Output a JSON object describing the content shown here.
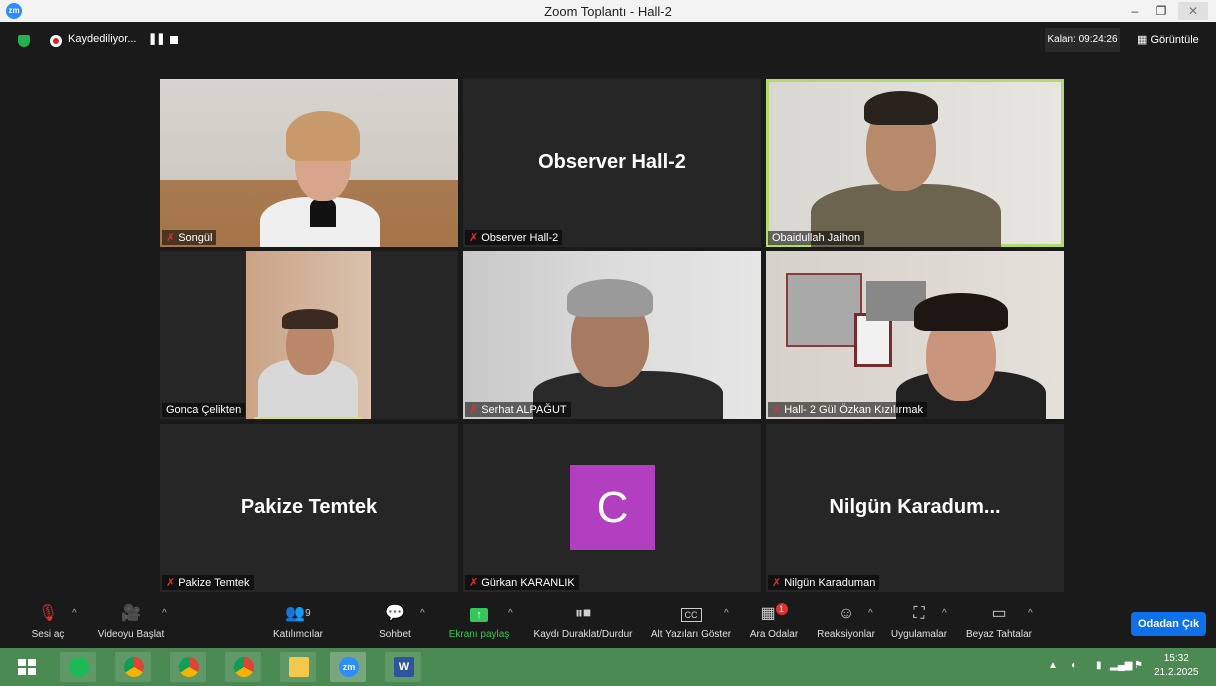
{
  "window": {
    "title": "Zoom Toplantı - Hall-2",
    "logo": "zm",
    "minimize": "–",
    "maximize": "❐",
    "close": "✕"
  },
  "status": {
    "recording": "Kaydediliyor...",
    "pause_icon": "❚❚",
    "remaining": "Kalan: 09:24:26",
    "view": "Görüntüle",
    "view_icon": "▦"
  },
  "tiles": [
    {
      "name": "Songül",
      "muted": true
    },
    {
      "name": "Observer Hall-2",
      "big": "Observer Hall-2",
      "muted": true
    },
    {
      "name": "Obaidullah Jaihon",
      "muted": false
    },
    {
      "name": "Gonca Çelikten",
      "muted": false
    },
    {
      "name": "Serhat ALPAĞUT",
      "muted": true
    },
    {
      "name": "Hall- 2 Gül Özkan Kızılırmak",
      "muted": true
    },
    {
      "name": "Pakize Temtek",
      "big": "Pakize Temtek",
      "muted": true
    },
    {
      "name": "Gürkan KARANLIK",
      "avatar": "C",
      "muted": true
    },
    {
      "name": "Nilgün Karaduman",
      "big": "Nilgün  Karadum...",
      "muted": true
    }
  ],
  "toolbar": {
    "unmute": "Sesi aç",
    "start_video": "Videoyu Başlat",
    "participants": "Katılımcılar",
    "participants_count": "9",
    "chat": "Sohbet",
    "share": "Ekranı paylaş",
    "recording_ctrl": "Kaydı Duraklat/Durdur",
    "captions": "Alt Yazıları Göster",
    "captions_icon": "CC",
    "breakout": "Ara Odalar",
    "breakout_badge": "1",
    "reactions": "Reaksiyonlar",
    "apps": "Uygulamalar",
    "whiteboard": "Beyaz Tahtalar",
    "leave": "Odadan Çık"
  },
  "taskbar": {
    "zoom_label": "zm",
    "word_label": "W",
    "tray_caret": "▲",
    "time": "15:32",
    "date": "21.2.2025"
  },
  "colors": {
    "accent": "#0e71eb",
    "active_speaker": "#b6d96c",
    "muted": "#e03030",
    "avatar": "#b13fbf",
    "taskbar": "#4b8a52"
  }
}
